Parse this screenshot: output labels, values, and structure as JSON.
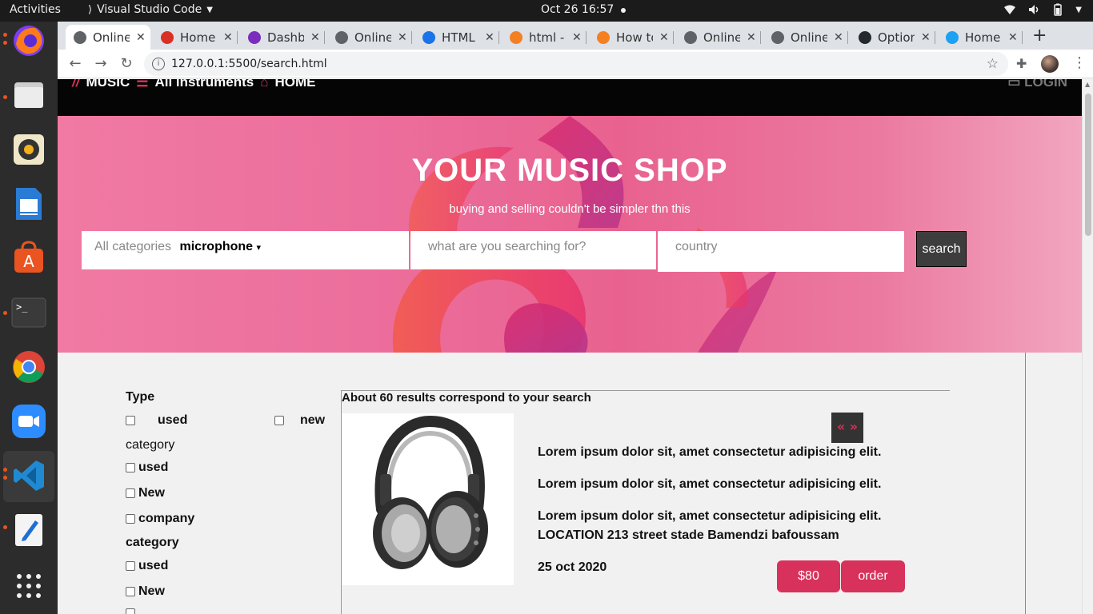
{
  "system": {
    "activities": "Activities",
    "app_name": "Visual Studio Code",
    "clock": "Oct 26  16:57"
  },
  "tabs": [
    {
      "title": "Online",
      "color": "#5f6368"
    },
    {
      "title": "Home",
      "color": "#d93025"
    },
    {
      "title": "Dashb",
      "color": "#7b2cbf"
    },
    {
      "title": "Online",
      "color": "#5f6368"
    },
    {
      "title": "HTML",
      "color": "#1a73e8"
    },
    {
      "title": "html -",
      "color": "#f48024"
    },
    {
      "title": "How to",
      "color": "#f48024"
    },
    {
      "title": "Online",
      "color": "#5f6368"
    },
    {
      "title": "Online",
      "color": "#5f6368"
    },
    {
      "title": "Option",
      "color": "#24292e"
    },
    {
      "title": "Home",
      "color": "#1da1f2"
    }
  ],
  "browser": {
    "url": "127.0.0.1:5500/search.html"
  },
  "site_nav": {
    "brand": "MUSIC",
    "all_instruments": "All instruments",
    "home": "HOME",
    "login": "LOGIN"
  },
  "hero": {
    "title": "YOUR MUSIC SHOP",
    "subtitle": "buying and selling couldn't be simpler thn this",
    "categories_label": "All categories",
    "categories_value": "microphone",
    "search_placeholder": "what are you searching for?",
    "country_placeholder": "country",
    "search_button": "search"
  },
  "filters": {
    "type_heading": "Type",
    "type_used": "used",
    "type_new": "new",
    "category1_heading": "category",
    "c1_used": "used",
    "c1_new": "New",
    "c1_company": "company",
    "category2_heading": "category",
    "c2_used": "used",
    "c2_new": "New"
  },
  "results": {
    "summary": "About 60 results correspond to your search",
    "pager": "« »",
    "desc1": "Lorem ipsum dolor sit, amet consectetur adipisicing elit.",
    "desc2": "Lorem ipsum dolor sit, amet consectetur adipisicing elit.",
    "desc3": "Lorem ipsum dolor sit, amet consectetur adipisicing elit.",
    "location": "LOCATION 213 street stade Bamendzi bafoussam",
    "date": "25 oct 2020",
    "price": "$80",
    "order": "order"
  },
  "colors": {
    "accent": "#d8315b",
    "hero_pink": "#e9628f",
    "nav_bg": "#050505"
  }
}
